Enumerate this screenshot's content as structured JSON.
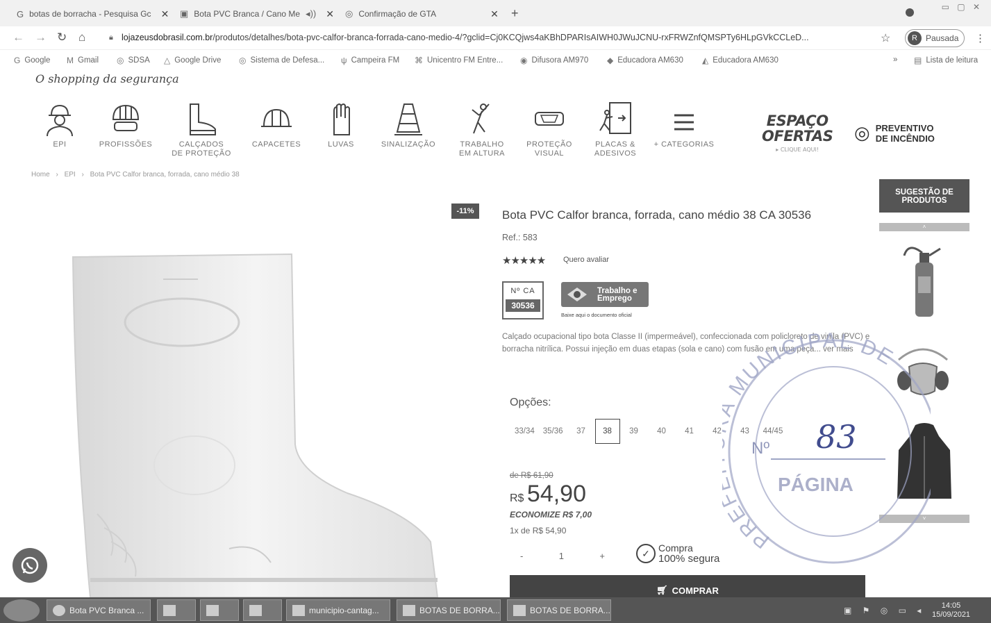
{
  "browser": {
    "tabs": [
      {
        "label": "botas de borracha - Pesquisa Gc",
        "icon": "google-icon"
      },
      {
        "label": "Bota PVC Branca / Cano Me",
        "icon": "page-icon"
      },
      {
        "label": "Confirmação de GTA",
        "icon": "globe-icon"
      }
    ],
    "url_prefix": "lojazeusdobrasil.com.br",
    "url_rest": "/produtos/detalhes/bota-pvc-calfor-branca-forrada-cano-medio-4/?gclid=Cj0KCQjws4aKBhDPARIsAIWH0JWuJCNU-rxFRWZnfQMSPTy6HLpGVkCCLeD...",
    "profile_initial": "R",
    "profile_label": "Pausada",
    "bookmarks": [
      {
        "label": "Google",
        "icon": "google-icon"
      },
      {
        "label": "Gmail",
        "icon": "gmail-icon"
      },
      {
        "label": "SDSA",
        "icon": "globe-icon"
      },
      {
        "label": "Google Drive",
        "icon": "drive-icon"
      },
      {
        "label": "Sistema de Defesa...",
        "icon": "globe-icon"
      },
      {
        "label": "Campeira FM",
        "icon": "radio-icon"
      },
      {
        "label": "Unicentro FM Entre...",
        "icon": "radio-icon"
      },
      {
        "label": "Difusora AM970",
        "icon": "radio-icon"
      },
      {
        "label": "Educadora AM630",
        "icon": "radio-icon"
      },
      {
        "label": "Educadora AM630",
        "icon": "radio-icon"
      }
    ],
    "more_bookmarks": "»",
    "reading_list": "Lista de leitura"
  },
  "site": {
    "tagline": "O shopping da segurança",
    "categories": [
      {
        "label": "EPI"
      },
      {
        "label": "PROFISSÕES"
      },
      {
        "label": "CALÇADOS\nDE PROTEÇÃO"
      },
      {
        "label": "CAPACETES"
      },
      {
        "label": "LUVAS"
      },
      {
        "label": "SINALIZAÇÃO"
      },
      {
        "label": "TRABALHO\nEM ALTURA"
      },
      {
        "label": "PROTEÇÃO\nVISUAL"
      },
      {
        "label": "PLACAS &\nADESIVOS"
      },
      {
        "label": "+ CATEGORIAS"
      }
    ],
    "espaco_line1": "ESPAÇO",
    "espaco_line2": "OFERTAS",
    "espaco_sub": "▸ CLIQUE AQUI!",
    "preventivo_line1": "PREVENTIVO",
    "preventivo_line2": "DE INCÊNDIO"
  },
  "breadcrumb": [
    "Home",
    "›",
    "EPI",
    "›",
    "Bota PVC Calfor branca, forrada, cano médio 38"
  ],
  "product": {
    "discount": "-11%",
    "title": "Bota PVC Calfor branca, forrada, cano médio 38   CA 30536",
    "ref": "Ref.: 583",
    "stars": "★★★★★",
    "rate_label": "Quero avaliar",
    "ca_label": "Nº CA",
    "ca_number": "30536",
    "trabalho_line1": "Trabalho e",
    "trabalho_line2": "Emprego",
    "trabalho_note": "Baixe aqui o documento oficial",
    "description": "Calçado ocupacional tipo bota Classe II (impermeável), confeccionada com policloreto de vinila (PVC) e borracha nitrílica. Possui injeção em duas etapas (sola e cano) com fusão em uma peça... ver mais",
    "options_label": "Opções:",
    "sizes": [
      "33/34",
      "35/36",
      "37",
      "38",
      "39",
      "40",
      "41",
      "42",
      "43",
      "44/45"
    ],
    "selected_size": "38",
    "old_price": "de R$ 61,90",
    "currency": "R$",
    "price": "54,90",
    "savings": "ECONOMIZE R$ 7,00",
    "installments": "1x de R$ 54,90",
    "qty_minus": "-",
    "qty": "1",
    "qty_plus": "+",
    "secure_line1": "Compra",
    "secure_line2": "100% segura",
    "buy_label": "COMPRAR"
  },
  "suggestion": {
    "title_line1": "SUGESTÃO DE",
    "title_line2": "PRODUTOS",
    "up": "˄",
    "down": "˅"
  },
  "stamp": {
    "ring_text": "PREFEITURA MUNICIPAL DE",
    "no_label": "Nº",
    "page_number": "83",
    "page_label": "PÁGINA"
  },
  "taskbar": {
    "items": [
      {
        "label": "Bota PVC Branca ..."
      },
      {
        "label": ""
      },
      {
        "label": ""
      },
      {
        "label": ""
      },
      {
        "label": "municipio-cantag..."
      },
      {
        "label": "BOTAS DE BORRA..."
      },
      {
        "label": "BOTAS DE BORRA..."
      }
    ],
    "time": "14:05",
    "date": "15/09/2021"
  }
}
